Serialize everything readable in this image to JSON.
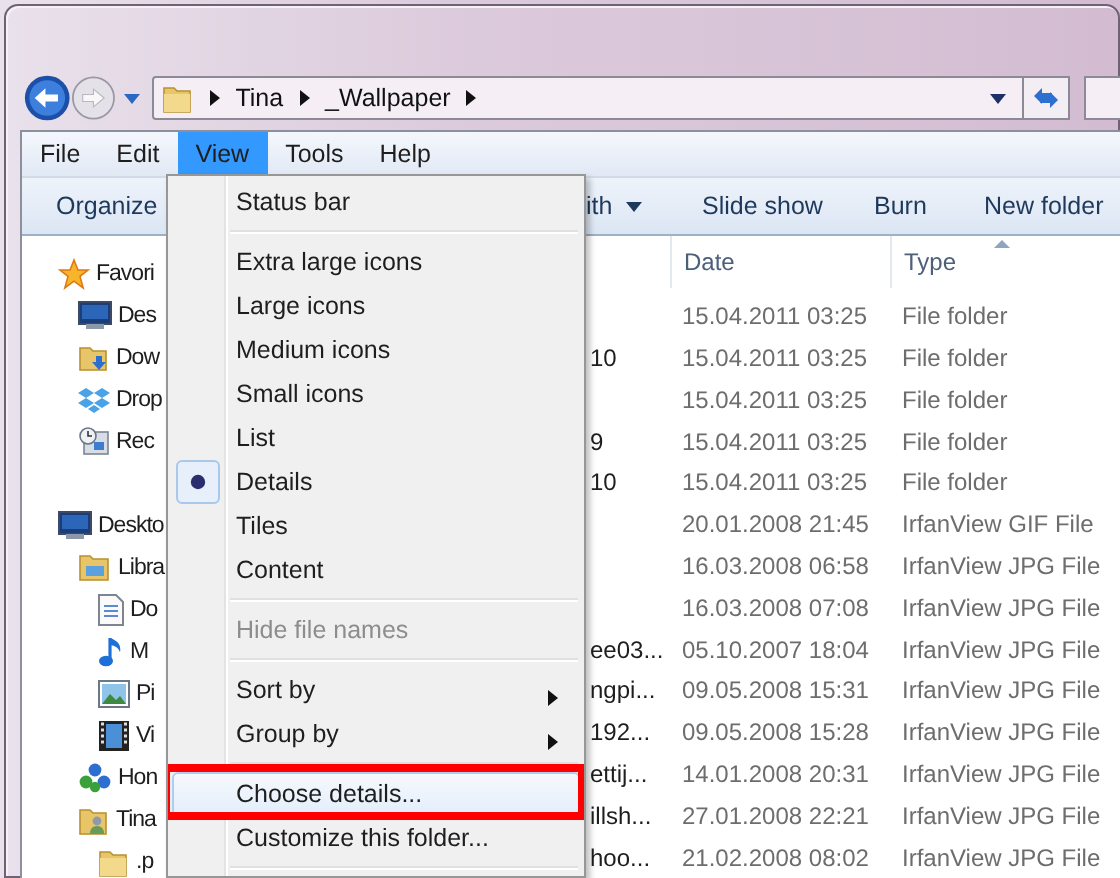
{
  "address": {
    "crumbs": [
      "Tina",
      "_Wallpaper"
    ]
  },
  "menubar": [
    {
      "label": "File",
      "selected": false
    },
    {
      "label": "Edit",
      "selected": false
    },
    {
      "label": "View",
      "selected": true
    },
    {
      "label": "Tools",
      "selected": false
    },
    {
      "label": "Help",
      "selected": false
    }
  ],
  "toolbar": [
    {
      "label": "Organize",
      "dropdown": false
    },
    {
      "label": "ith",
      "dropdown": true
    },
    {
      "label": "Slide show",
      "dropdown": false
    },
    {
      "label": "Burn",
      "dropdown": false
    },
    {
      "label": "New folder",
      "dropdown": false
    }
  ],
  "navigation": [
    {
      "label": "Favori",
      "kind": "star",
      "children": [
        {
          "label": "Des",
          "kind": "monitor"
        },
        {
          "label": "Dow",
          "kind": "download"
        },
        {
          "label": "Drop",
          "kind": "boxes"
        },
        {
          "label": "Rec",
          "kind": "recent"
        }
      ]
    },
    {
      "label": "Deskto",
      "kind": "monitor",
      "children": [
        {
          "label": "Libra",
          "kind": "library",
          "children": [
            {
              "label": "Do",
              "kind": "document"
            },
            {
              "label": "M",
              "kind": "music"
            },
            {
              "label": "Pi",
              "kind": "picture"
            },
            {
              "label": "Vi",
              "kind": "video"
            }
          ]
        },
        {
          "label": "Hon",
          "kind": "homegroup"
        },
        {
          "label": "Tina",
          "kind": "user",
          "children": [
            {
              "label": ".p",
              "kind": "folder"
            }
          ]
        }
      ]
    }
  ],
  "file_list": {
    "columns": [
      {
        "label": "Date",
        "sorted": false
      },
      {
        "label": "Type",
        "sorted": true
      }
    ],
    "rows": [
      {
        "date": "15.04.2011 03:25",
        "type": "File folder"
      },
      {
        "name": "10",
        "date": "15.04.2011 03:25",
        "type": "File folder"
      },
      {
        "date": "15.04.2011 03:25",
        "type": "File folder"
      },
      {
        "name": "9",
        "date": "15.04.2011 03:25",
        "type": "File folder"
      },
      {
        "name": "10",
        "date": "15.04.2011 03:25",
        "type": "File folder"
      },
      {
        "date": "20.01.2008 21:45",
        "type": "IrfanView GIF File"
      },
      {
        "date": "16.03.2008 06:58",
        "type": "IrfanView JPG File"
      },
      {
        "date": "16.03.2008 07:08",
        "type": "IrfanView JPG File"
      },
      {
        "name": "ee03...",
        "date": "05.10.2007 18:04",
        "type": "IrfanView JPG File"
      },
      {
        "name": "ngpi...",
        "date": "09.05.2008 15:31",
        "type": "IrfanView JPG File"
      },
      {
        "name": "192...",
        "date": "09.05.2008 15:28",
        "type": "IrfanView JPG File"
      },
      {
        "name": "ettij...",
        "date": "14.01.2008 20:31",
        "type": "IrfanView JPG File"
      },
      {
        "name": "illsh...",
        "date": "27.01.2008 22:21",
        "type": "IrfanView JPG File"
      },
      {
        "name": "hoo...",
        "date": "21.02.2008 08:02",
        "type": "IrfanView JPG File"
      }
    ]
  },
  "view_menu": [
    {
      "kind": "item",
      "label": "Status bar",
      "checked": false,
      "disabled": false,
      "submenu": false,
      "selected": false,
      "annotated": false
    },
    {
      "kind": "separator"
    },
    {
      "kind": "item",
      "label": "Extra large icons",
      "checked": false,
      "disabled": false,
      "submenu": false,
      "selected": false,
      "annotated": false
    },
    {
      "kind": "item",
      "label": "Large icons",
      "checked": false,
      "disabled": false,
      "submenu": false,
      "selected": false,
      "annotated": false
    },
    {
      "kind": "item",
      "label": "Medium icons",
      "checked": false,
      "disabled": false,
      "submenu": false,
      "selected": false,
      "annotated": false
    },
    {
      "kind": "item",
      "label": "Small icons",
      "checked": false,
      "disabled": false,
      "submenu": false,
      "selected": false,
      "annotated": false
    },
    {
      "kind": "item",
      "label": "List",
      "checked": false,
      "disabled": false,
      "submenu": false,
      "selected": false,
      "annotated": false
    },
    {
      "kind": "item",
      "label": "Details",
      "checked": true,
      "disabled": false,
      "submenu": false,
      "selected": false,
      "annotated": false
    },
    {
      "kind": "item",
      "label": "Tiles",
      "checked": false,
      "disabled": false,
      "submenu": false,
      "selected": false,
      "annotated": false
    },
    {
      "kind": "item",
      "label": "Content",
      "checked": false,
      "disabled": false,
      "submenu": false,
      "selected": false,
      "annotated": false
    },
    {
      "kind": "separator"
    },
    {
      "kind": "item",
      "label": "Hide file names",
      "checked": false,
      "disabled": true,
      "submenu": false,
      "selected": false,
      "annotated": false
    },
    {
      "kind": "separator"
    },
    {
      "kind": "item",
      "label": "Sort by",
      "checked": false,
      "disabled": false,
      "submenu": true,
      "selected": false,
      "annotated": false
    },
    {
      "kind": "item",
      "label": "Group by",
      "checked": false,
      "disabled": false,
      "submenu": true,
      "selected": false,
      "annotated": false
    },
    {
      "kind": "separator"
    },
    {
      "kind": "item",
      "label": "Choose details...",
      "checked": false,
      "disabled": false,
      "submenu": false,
      "selected": true,
      "annotated": true
    },
    {
      "kind": "item",
      "label": "Customize this folder...",
      "checked": false,
      "disabled": false,
      "submenu": false,
      "selected": false,
      "annotated": false
    },
    {
      "kind": "separator"
    }
  ]
}
